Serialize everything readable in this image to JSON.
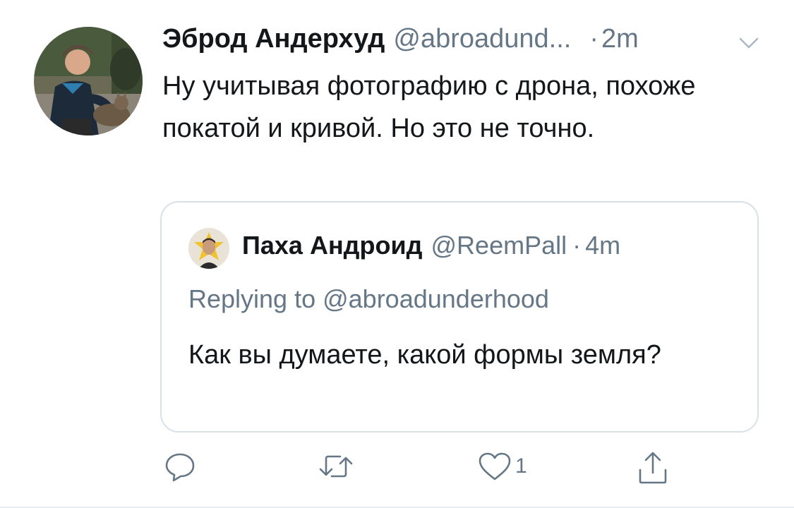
{
  "tweet": {
    "display_name": "Эброд Андерхуд",
    "handle": "@abroadund...",
    "separator": "·",
    "time": "2m",
    "text": "Ну учитывая фотографию с дрона, похоже покатой и кривой. Но это не точно."
  },
  "quoted_tweet": {
    "display_name": "Паха Андроид",
    "handle": "@ReemPall",
    "separator": "·",
    "time": "4m",
    "replying_to": "Replying to @abroadunderhood",
    "text": "Как вы думаете, какой формы земля?"
  },
  "actions": {
    "reply_icon": "reply-icon",
    "retweet_icon": "retweet-icon",
    "like_icon": "heart-icon",
    "like_count": "1",
    "share_icon": "share-icon"
  },
  "colors": {
    "text_primary": "#14171a",
    "text_secondary": "#657786",
    "border": "#d9e1e8"
  }
}
